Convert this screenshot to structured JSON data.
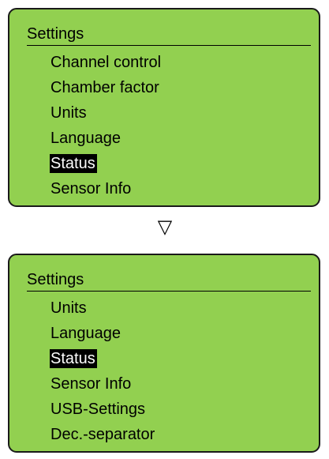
{
  "colors": {
    "screen_background": "#92d050",
    "screen_border": "#1a1a1a",
    "selection_background": "#000000",
    "selection_text": "#ffffff"
  },
  "screens": [
    {
      "title": "Settings",
      "items": [
        {
          "label": "Channel control",
          "selected": false
        },
        {
          "label": "Chamber factor",
          "selected": false
        },
        {
          "label": "Units",
          "selected": false
        },
        {
          "label": "Language",
          "selected": false
        },
        {
          "label": "Status",
          "selected": true
        },
        {
          "label": "Sensor Info",
          "selected": false
        }
      ]
    },
    {
      "title": "Settings",
      "items": [
        {
          "label": "Units",
          "selected": false
        },
        {
          "label": "Language",
          "selected": false
        },
        {
          "label": "Status",
          "selected": true
        },
        {
          "label": "Sensor Info",
          "selected": false
        },
        {
          "label": "USB-Settings",
          "selected": false
        },
        {
          "label": "Dec.-separator",
          "selected": false
        }
      ]
    }
  ],
  "transition": {
    "icon": "down-triangle-icon",
    "glyph": "▽"
  }
}
